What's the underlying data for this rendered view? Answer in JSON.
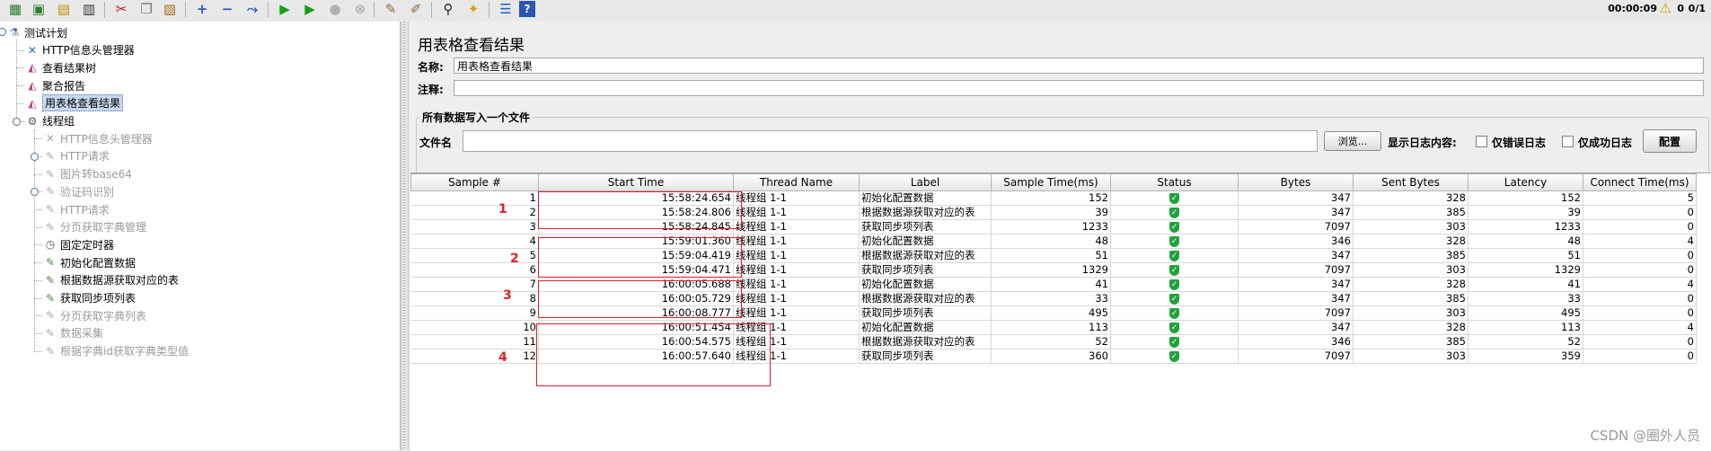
{
  "toolbar": {
    "timer": "00:00:09",
    "error_count": "0",
    "threads": "0/1"
  },
  "tree": {
    "root": "测试计划",
    "items": [
      {
        "label": "HTTP信息头管理器",
        "icon": "wrench-icon",
        "disabled": false
      },
      {
        "label": "查看结果树",
        "icon": "graph-icon",
        "disabled": false
      },
      {
        "label": "聚合报告",
        "icon": "graph-icon",
        "disabled": false
      },
      {
        "label": "用表格查看结果",
        "icon": "graph-icon",
        "disabled": false,
        "selected": true
      }
    ],
    "thread_group": "线程组",
    "children": [
      {
        "label": "HTTP信息头管理器",
        "icon": "wrench-icon",
        "disabled": true
      },
      {
        "label": "HTTP请求",
        "icon": "pen-icon",
        "disabled": true
      },
      {
        "label": "图片转base64",
        "icon": "pen-icon",
        "disabled": true
      },
      {
        "label": "验证码识别",
        "icon": "pen-icon",
        "disabled": true
      },
      {
        "label": "HTTP请求",
        "icon": "pen-icon",
        "disabled": true
      },
      {
        "label": "分页获取字典管理",
        "icon": "pen-icon",
        "disabled": true
      },
      {
        "label": "固定定时器",
        "icon": "clock-icon",
        "disabled": false
      },
      {
        "label": "初始化配置数据",
        "icon": "pen-icon",
        "disabled": false
      },
      {
        "label": "根据数据源获取对应的表",
        "icon": "pen-icon",
        "disabled": false
      },
      {
        "label": "获取同步项列表",
        "icon": "pen-icon",
        "disabled": false
      },
      {
        "label": "分页获取字典列表",
        "icon": "pen-icon",
        "disabled": true
      },
      {
        "label": "数据采集",
        "icon": "pen-icon",
        "disabled": true
      },
      {
        "label": "根据字典id获取字典类型值",
        "icon": "pen-icon",
        "disabled": true
      }
    ]
  },
  "panel": {
    "title": "用表格查看结果",
    "name_label": "名称:",
    "name_value": "用表格查看结果",
    "comment_label": "注释:",
    "comment_value": "",
    "file_section": "所有数据写入一个文件",
    "file_label": "文件名",
    "file_value": "",
    "browse_button": "浏览...",
    "log_label": "显示日志内容:",
    "errors_only": "仅错误日志",
    "success_only": "仅成功日志",
    "config_button": "配置"
  },
  "table": {
    "columns": [
      "Sample #",
      "Start Time",
      "Thread Name",
      "Label",
      "Sample Time(ms)",
      "Status",
      "Bytes",
      "Sent Bytes",
      "Latency",
      "Connect Time(ms)"
    ],
    "rows": [
      [
        "1",
        "15:58:24.654",
        "线程组 1-1",
        "初始化配置数据",
        "152",
        "ok",
        "347",
        "328",
        "152",
        "5"
      ],
      [
        "2",
        "15:58:24.806",
        "线程组 1-1",
        "根据数据源获取对应的表",
        "39",
        "ok",
        "347",
        "385",
        "39",
        "0"
      ],
      [
        "3",
        "15:58:24.845",
        "线程组 1-1",
        "获取同步项列表",
        "1233",
        "ok",
        "7097",
        "303",
        "1233",
        "0"
      ],
      [
        "4",
        "15:59:01.360",
        "线程组 1-1",
        "初始化配置数据",
        "48",
        "ok",
        "346",
        "328",
        "48",
        "4"
      ],
      [
        "5",
        "15:59:04.419",
        "线程组 1-1",
        "根据数据源获取对应的表",
        "51",
        "ok",
        "347",
        "385",
        "51",
        "0"
      ],
      [
        "6",
        "15:59:04.471",
        "线程组 1-1",
        "获取同步项列表",
        "1329",
        "ok",
        "7097",
        "303",
        "1329",
        "0"
      ],
      [
        "7",
        "16:00:05.688",
        "线程组 1-1",
        "初始化配置数据",
        "41",
        "ok",
        "347",
        "328",
        "41",
        "4"
      ],
      [
        "8",
        "16:00:05.729",
        "线程组 1-1",
        "根据数据源获取对应的表",
        "33",
        "ok",
        "347",
        "385",
        "33",
        "0"
      ],
      [
        "9",
        "16:00:08.777",
        "线程组 1-1",
        "获取同步项列表",
        "495",
        "ok",
        "7097",
        "303",
        "495",
        "0"
      ],
      [
        "10",
        "16:00:51.454",
        "线程组 1-1",
        "初始化配置数据",
        "113",
        "ok",
        "347",
        "328",
        "113",
        "4"
      ],
      [
        "11",
        "16:00:54.575",
        "线程组 1-1",
        "根据数据源获取对应的表",
        "52",
        "ok",
        "346",
        "385",
        "52",
        "0"
      ],
      [
        "12",
        "16:00:57.640",
        "线程组 1-1",
        "获取同步项列表",
        "360",
        "ok",
        "7097",
        "303",
        "359",
        "0"
      ]
    ]
  },
  "annotations": [
    "1",
    "2",
    "3",
    "4"
  ],
  "watermark": "CSDN @圈外人员"
}
